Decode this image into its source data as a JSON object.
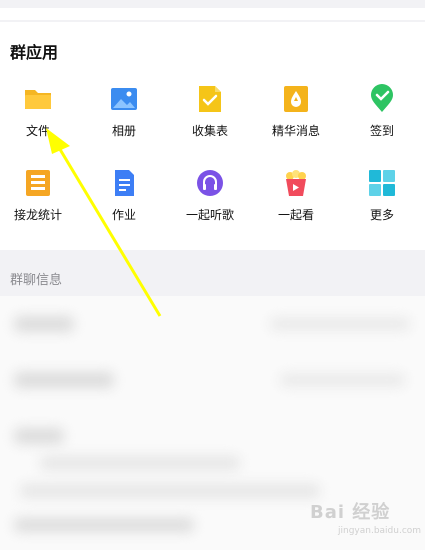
{
  "group_apps": {
    "title": "群应用",
    "apps": [
      {
        "label": "文件",
        "icon": "folder-icon"
      },
      {
        "label": "相册",
        "icon": "photo-album-icon"
      },
      {
        "label": "收集表",
        "icon": "form-icon"
      },
      {
        "label": "精华消息",
        "icon": "highlight-message-icon"
      },
      {
        "label": "签到",
        "icon": "check-in-icon"
      },
      {
        "label": "接龙统计",
        "icon": "relay-stats-icon"
      },
      {
        "label": "作业",
        "icon": "homework-icon"
      },
      {
        "label": "一起听歌",
        "icon": "headphones-icon"
      },
      {
        "label": "一起看",
        "icon": "popcorn-icon"
      },
      {
        "label": "更多",
        "icon": "more-grid-icon"
      }
    ]
  },
  "group_info": {
    "title": "群聊信息"
  },
  "watermark": {
    "text": "Bai 经验",
    "sub": "jingyan.baidu.com"
  },
  "colors": {
    "folder": "#f5b623",
    "photo": "#3b8cf0",
    "form": "#f5c518",
    "highlight": "#f4b31b",
    "checkin": "#2ec463",
    "relay": "#f5a623",
    "homework": "#3d7ef5",
    "music": "#7b52e6",
    "popcorn": "#f14b5c",
    "more": "#20b9d8",
    "arrow": "#ffff00"
  }
}
